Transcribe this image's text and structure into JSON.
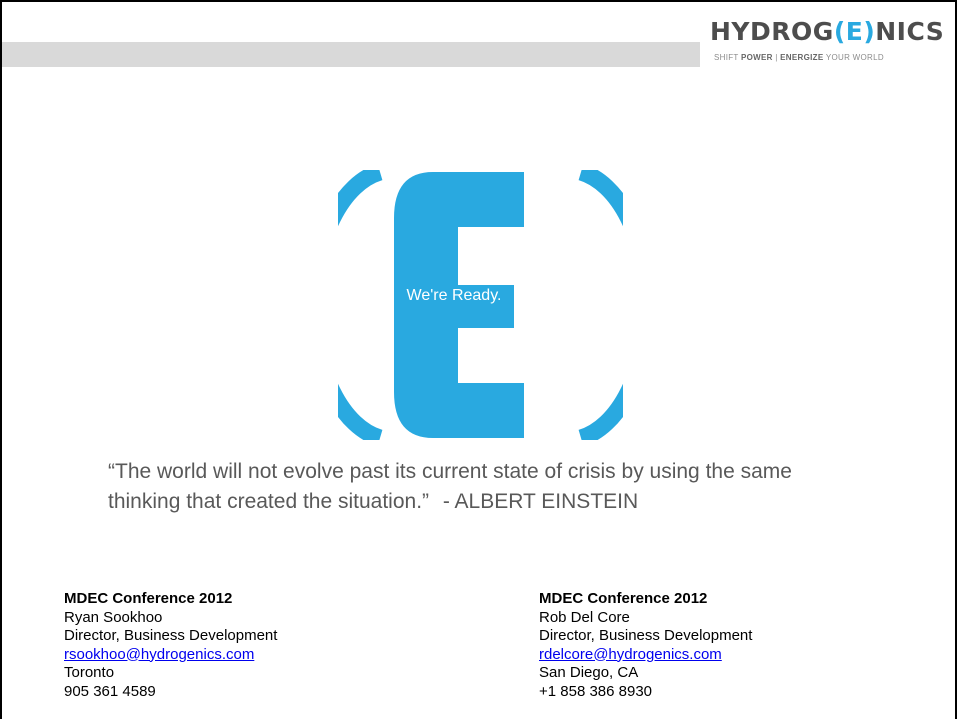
{
  "brand": {
    "name_before": "HYDROG",
    "name_mark": "(E)",
    "name_after": "NICS",
    "tagline_a": "SHIFT ",
    "tagline_b": "POWER",
    "tagline_c": " | ",
    "tagline_d": "ENERGIZE",
    "tagline_e": " YOUR WORLD"
  },
  "logo": {
    "tagline": "We're Ready.",
    "color": "#29a9e0"
  },
  "quote": {
    "text": "“The world will not evolve past its current state of crisis by using the same thinking that created the situation.”",
    "author": " - ALBERT EINSTEIN"
  },
  "contacts": [
    {
      "conference": "MDEC Conference 2012",
      "name": "Ryan Sookhoo",
      "title": "Director, Business Development",
      "email": "rsookhoo@hydrogenics.com",
      "city": "Toronto",
      "phone": "905 361 4589"
    },
    {
      "conference": "MDEC Conference 2012",
      "name": "Rob Del Core",
      "title": "Director, Business Development",
      "email": "rdelcore@hydrogenics.com",
      "city": "San Diego, CA",
      "phone": "+1 858 386 8930"
    }
  ]
}
